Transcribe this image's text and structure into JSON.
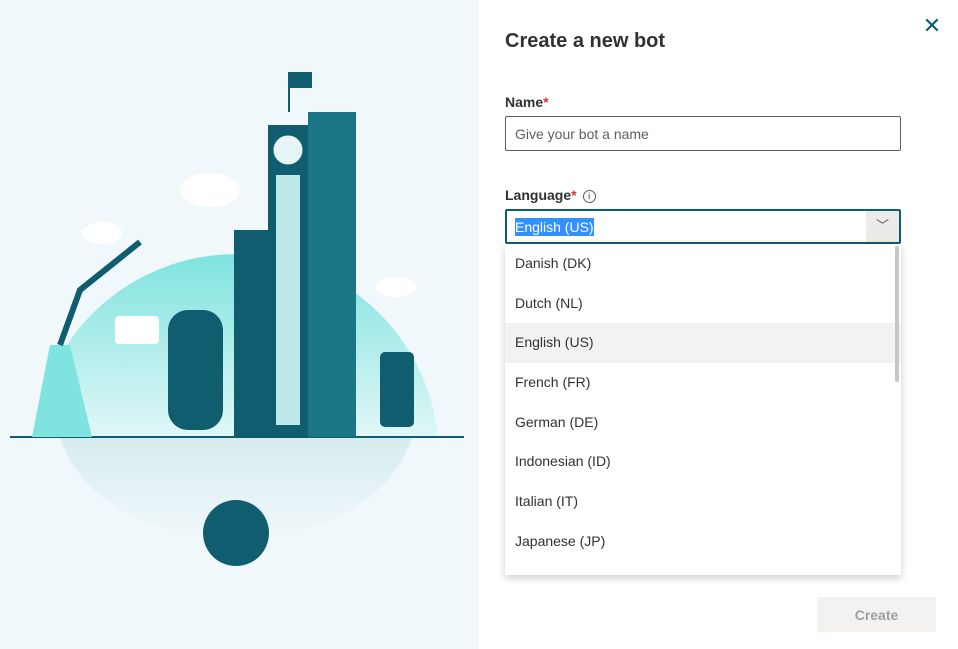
{
  "dialog": {
    "title": "Create a new bot",
    "close_icon": "close-icon"
  },
  "name_field": {
    "label": "Name",
    "required_mark": "*",
    "placeholder": "Give your bot a name",
    "value": ""
  },
  "language_field": {
    "label": "Language",
    "required_mark": "*",
    "info_icon": "i",
    "selected": "English (US)",
    "chevron": "﹀",
    "options": [
      "Danish (DK)",
      "Dutch (NL)",
      "English (US)",
      "French (FR)",
      "German (DE)",
      "Indonesian (ID)",
      "Italian (IT)",
      "Japanese (JP)"
    ]
  },
  "create_button": "Create",
  "colors": {
    "accent": "#0f5d6e",
    "illustration_teal": "#6fded8",
    "selection": "#3390ff"
  }
}
